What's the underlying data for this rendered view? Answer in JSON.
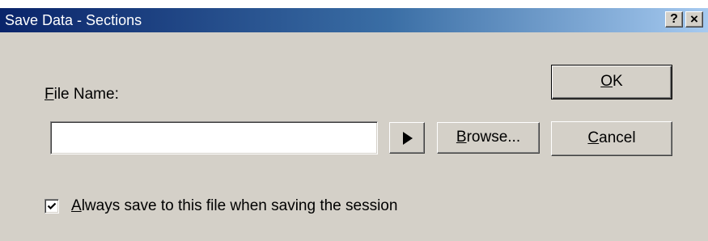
{
  "window": {
    "title": "Save Data - Sections",
    "help_label": "?",
    "close_label": "×"
  },
  "form": {
    "file_name_label_underlined": "F",
    "file_name_label_rest": "ile Name:",
    "file_name_value": "",
    "browse_label_underlined": "B",
    "browse_label_rest": "rowse...",
    "always_save_checked": true,
    "always_save_label_underlined": "A",
    "always_save_label_rest": "lways save to this file when saving the session"
  },
  "buttons": {
    "ok_underlined": "O",
    "ok_rest": "K",
    "cancel_underlined": "C",
    "cancel_rest": "ancel"
  },
  "icons": {
    "arrow": "play-arrow-icon",
    "check": "checkmark-icon"
  }
}
